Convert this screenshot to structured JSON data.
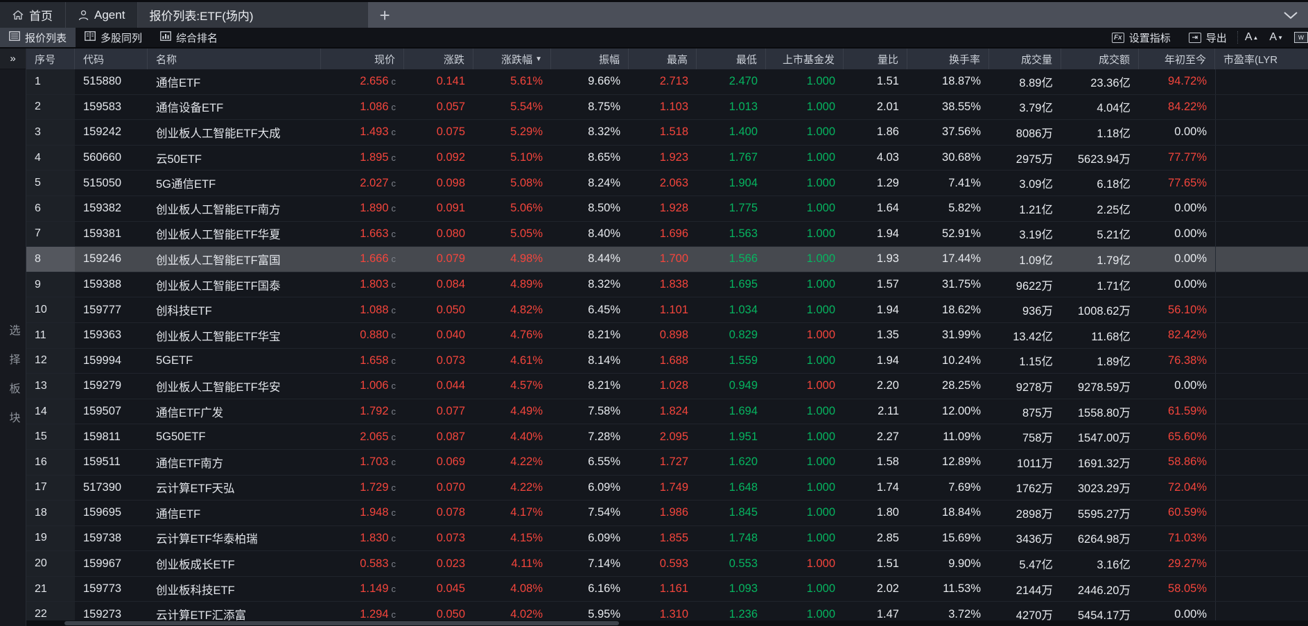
{
  "titlebar": {
    "home_tab": "首页",
    "agent_tab": "Agent",
    "doc_tab": "报价列表:ETF(场内)",
    "new_tab": "+"
  },
  "toolbar": {
    "quote_list": "报价列表",
    "multi_stock": "多股同列",
    "composite_rank": "综合排名",
    "set_indicator": "设置指标",
    "export": "导出",
    "fx_icon_label": "Fx",
    "font_larger": "A",
    "font_smaller": "A",
    "w_icon_label": "w"
  },
  "sidebar": {
    "expander": "»",
    "vertical_label": "选择板块"
  },
  "table": {
    "price_suffix": "c",
    "sort_icon": "▼",
    "columns": [
      {
        "key": "seq",
        "label": "序号",
        "align": "left"
      },
      {
        "key": "code",
        "label": "代码",
        "align": "left"
      },
      {
        "key": "name",
        "label": "名称",
        "align": "left"
      },
      {
        "key": "price",
        "label": "现价",
        "align": "right"
      },
      {
        "key": "change",
        "label": "涨跌",
        "align": "right"
      },
      {
        "key": "pct",
        "label": "涨跌幅",
        "align": "right",
        "sorted": true
      },
      {
        "key": "amplitude",
        "label": "振幅",
        "align": "right"
      },
      {
        "key": "high",
        "label": "最高",
        "align": "right"
      },
      {
        "key": "low",
        "label": "最低",
        "align": "right"
      },
      {
        "key": "issue",
        "label": "上市基金发",
        "align": "right"
      },
      {
        "key": "ratio",
        "label": "量比",
        "align": "right"
      },
      {
        "key": "turnover",
        "label": "换手率",
        "align": "right"
      },
      {
        "key": "volume",
        "label": "成交量",
        "align": "right"
      },
      {
        "key": "amount",
        "label": "成交额",
        "align": "right"
      },
      {
        "key": "ytd",
        "label": "年初至今",
        "align": "right"
      },
      {
        "key": "pe",
        "label": "市盈率(LYR",
        "align": "left",
        "fill": true
      }
    ],
    "rows": [
      {
        "seq": "1",
        "code": "515880",
        "name": "通信ETF",
        "price": "2.656",
        "chg": "0.141",
        "pct": "5.61%",
        "amp": "9.66%",
        "high": "2.713",
        "low": "2.470",
        "issue": "1.000",
        "issueColor": "g",
        "ratio": "1.51",
        "turn": "18.87%",
        "vol": "8.89亿",
        "amt": "23.36亿",
        "ytd": "94.72%"
      },
      {
        "seq": "2",
        "code": "159583",
        "name": "通信设备ETF",
        "price": "1.086",
        "chg": "0.057",
        "pct": "5.54%",
        "amp": "8.75%",
        "high": "1.103",
        "low": "1.013",
        "issue": "1.000",
        "issueColor": "g",
        "ratio": "2.01",
        "turn": "38.55%",
        "vol": "3.79亿",
        "amt": "4.04亿",
        "ytd": "84.22%"
      },
      {
        "seq": "3",
        "code": "159242",
        "name": "创业板人工智能ETF大成",
        "price": "1.493",
        "chg": "0.075",
        "pct": "5.29%",
        "amp": "8.32%",
        "high": "1.518",
        "low": "1.400",
        "issue": "1.000",
        "issueColor": "g",
        "ratio": "1.86",
        "turn": "37.56%",
        "vol": "8086万",
        "amt": "1.18亿",
        "ytd": "0.00%"
      },
      {
        "seq": "4",
        "code": "560660",
        "name": "云50ETF",
        "price": "1.895",
        "chg": "0.092",
        "pct": "5.10%",
        "amp": "8.65%",
        "high": "1.923",
        "low": "1.767",
        "issue": "1.000",
        "issueColor": "g",
        "ratio": "4.03",
        "turn": "30.68%",
        "vol": "2975万",
        "amt": "5623.94万",
        "ytd": "77.77%"
      },
      {
        "seq": "5",
        "code": "515050",
        "name": "5G通信ETF",
        "price": "2.027",
        "chg": "0.098",
        "pct": "5.08%",
        "amp": "8.24%",
        "high": "2.063",
        "low": "1.904",
        "issue": "1.000",
        "issueColor": "g",
        "ratio": "1.29",
        "turn": "7.41%",
        "vol": "3.09亿",
        "amt": "6.18亿",
        "ytd": "77.65%"
      },
      {
        "seq": "6",
        "code": "159382",
        "name": "创业板人工智能ETF南方",
        "price": "1.890",
        "chg": "0.091",
        "pct": "5.06%",
        "amp": "8.50%",
        "high": "1.928",
        "low": "1.775",
        "issue": "1.000",
        "issueColor": "g",
        "ratio": "1.64",
        "turn": "5.82%",
        "vol": "1.21亿",
        "amt": "2.25亿",
        "ytd": "0.00%"
      },
      {
        "seq": "7",
        "code": "159381",
        "name": "创业板人工智能ETF华夏",
        "price": "1.663",
        "chg": "0.080",
        "pct": "5.05%",
        "amp": "8.40%",
        "high": "1.696",
        "low": "1.563",
        "issue": "1.000",
        "issueColor": "g",
        "ratio": "1.94",
        "turn": "52.91%",
        "vol": "3.19亿",
        "amt": "5.21亿",
        "ytd": "0.00%"
      },
      {
        "seq": "8",
        "code": "159246",
        "name": "创业板人工智能ETF富国",
        "price": "1.666",
        "chg": "0.079",
        "pct": "4.98%",
        "amp": "8.44%",
        "high": "1.700",
        "low": "1.566",
        "issue": "1.000",
        "issueColor": "g",
        "ratio": "1.93",
        "turn": "17.44%",
        "vol": "1.09亿",
        "amt": "1.79亿",
        "ytd": "0.00%",
        "selected": true
      },
      {
        "seq": "9",
        "code": "159388",
        "name": "创业板人工智能ETF国泰",
        "price": "1.803",
        "chg": "0.084",
        "pct": "4.89%",
        "amp": "8.32%",
        "high": "1.838",
        "low": "1.695",
        "issue": "1.000",
        "issueColor": "g",
        "ratio": "1.57",
        "turn": "31.75%",
        "vol": "9622万",
        "amt": "1.71亿",
        "ytd": "0.00%"
      },
      {
        "seq": "10",
        "code": "159777",
        "name": "创科技ETF",
        "price": "1.088",
        "chg": "0.050",
        "pct": "4.82%",
        "amp": "6.45%",
        "high": "1.101",
        "low": "1.034",
        "issue": "1.000",
        "issueColor": "g",
        "ratio": "1.94",
        "turn": "18.62%",
        "vol": "936万",
        "amt": "1008.62万",
        "ytd": "56.10%"
      },
      {
        "seq": "11",
        "code": "159363",
        "name": "创业板人工智能ETF华宝",
        "price": "0.880",
        "chg": "0.040",
        "pct": "4.76%",
        "amp": "8.21%",
        "high": "0.898",
        "low": "0.829",
        "issue": "1.000",
        "issueColor": "r",
        "ratio": "1.35",
        "turn": "31.99%",
        "vol": "13.42亿",
        "amt": "11.68亿",
        "ytd": "82.42%"
      },
      {
        "seq": "12",
        "code": "159994",
        "name": "5GETF",
        "price": "1.658",
        "chg": "0.073",
        "pct": "4.61%",
        "amp": "8.14%",
        "high": "1.688",
        "low": "1.559",
        "issue": "1.000",
        "issueColor": "g",
        "ratio": "1.94",
        "turn": "10.24%",
        "vol": "1.15亿",
        "amt": "1.89亿",
        "ytd": "76.38%"
      },
      {
        "seq": "13",
        "code": "159279",
        "name": "创业板人工智能ETF华安",
        "price": "1.006",
        "chg": "0.044",
        "pct": "4.57%",
        "amp": "8.21%",
        "high": "1.028",
        "low": "0.949",
        "issue": "1.000",
        "issueColor": "r",
        "ratio": "2.20",
        "turn": "28.25%",
        "vol": "9278万",
        "amt": "9278.59万",
        "ytd": "0.00%"
      },
      {
        "seq": "14",
        "code": "159507",
        "name": "通信ETF广发",
        "price": "1.792",
        "chg": "0.077",
        "pct": "4.49%",
        "amp": "7.58%",
        "high": "1.824",
        "low": "1.694",
        "issue": "1.000",
        "issueColor": "g",
        "ratio": "2.11",
        "turn": "12.00%",
        "vol": "875万",
        "amt": "1558.80万",
        "ytd": "61.59%"
      },
      {
        "seq": "15",
        "code": "159811",
        "name": "5G50ETF",
        "price": "2.065",
        "chg": "0.087",
        "pct": "4.40%",
        "amp": "7.28%",
        "high": "2.095",
        "low": "1.951",
        "issue": "1.000",
        "issueColor": "g",
        "ratio": "2.27",
        "turn": "11.09%",
        "vol": "758万",
        "amt": "1547.00万",
        "ytd": "65.60%"
      },
      {
        "seq": "16",
        "code": "159511",
        "name": "通信ETF南方",
        "price": "1.703",
        "chg": "0.069",
        "pct": "4.22%",
        "amp": "6.55%",
        "high": "1.727",
        "low": "1.620",
        "issue": "1.000",
        "issueColor": "g",
        "ratio": "1.58",
        "turn": "12.89%",
        "vol": "1011万",
        "amt": "1691.32万",
        "ytd": "58.86%"
      },
      {
        "seq": "17",
        "code": "517390",
        "name": "云计算ETF天弘",
        "price": "1.729",
        "chg": "0.070",
        "pct": "4.22%",
        "amp": "6.09%",
        "high": "1.749",
        "low": "1.648",
        "issue": "1.000",
        "issueColor": "g",
        "ratio": "1.74",
        "turn": "7.69%",
        "vol": "1762万",
        "amt": "3023.29万",
        "ytd": "72.04%"
      },
      {
        "seq": "18",
        "code": "159695",
        "name": "通信ETF",
        "price": "1.948",
        "chg": "0.078",
        "pct": "4.17%",
        "amp": "7.54%",
        "high": "1.986",
        "low": "1.845",
        "issue": "1.000",
        "issueColor": "g",
        "ratio": "1.80",
        "turn": "18.84%",
        "vol": "2898万",
        "amt": "5595.27万",
        "ytd": "60.59%"
      },
      {
        "seq": "19",
        "code": "159738",
        "name": "云计算ETF华泰柏瑞",
        "price": "1.830",
        "chg": "0.073",
        "pct": "4.15%",
        "amp": "6.09%",
        "high": "1.855",
        "low": "1.748",
        "issue": "1.000",
        "issueColor": "g",
        "ratio": "2.85",
        "turn": "15.69%",
        "vol": "3436万",
        "amt": "6264.98万",
        "ytd": "71.03%"
      },
      {
        "seq": "20",
        "code": "159967",
        "name": "创业板成长ETF",
        "price": "0.583",
        "chg": "0.023",
        "pct": "4.11%",
        "amp": "7.14%",
        "high": "0.593",
        "low": "0.553",
        "issue": "1.000",
        "issueColor": "r",
        "ratio": "1.51",
        "turn": "9.90%",
        "vol": "5.47亿",
        "amt": "3.16亿",
        "ytd": "29.27%"
      },
      {
        "seq": "21",
        "code": "159773",
        "name": "创业板科技ETF",
        "price": "1.149",
        "chg": "0.045",
        "pct": "4.08%",
        "amp": "6.16%",
        "high": "1.161",
        "low": "1.093",
        "issue": "1.000",
        "issueColor": "g",
        "ratio": "2.02",
        "turn": "11.53%",
        "vol": "2144万",
        "amt": "2446.20万",
        "ytd": "58.05%"
      },
      {
        "seq": "22",
        "code": "159273",
        "name": "云计算ETF汇添富",
        "price": "1.294",
        "chg": "0.050",
        "pct": "4.02%",
        "amp": "5.95%",
        "high": "1.310",
        "low": "1.236",
        "issue": "1.000",
        "issueColor": "g",
        "ratio": "1.47",
        "turn": "3.72%",
        "vol": "4270万",
        "amt": "5454.17万",
        "ytd": "0.00%"
      }
    ]
  },
  "colors": {
    "up_red": "#f4453c",
    "down_green": "#06b560",
    "selected_row": "#46494f"
  }
}
